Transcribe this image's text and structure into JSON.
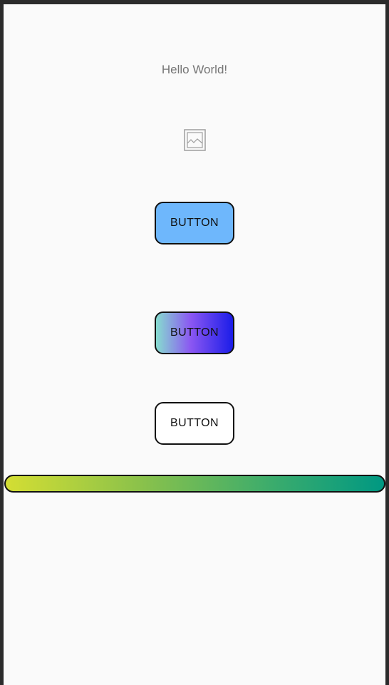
{
  "screen": {
    "hello_text": "Hello World!",
    "image_icon": "image-placeholder-icon"
  },
  "buttons": [
    {
      "label": "BUTTON",
      "style": "solid",
      "color": "#6eb7fc"
    },
    {
      "label": "BUTTON",
      "style": "gradient",
      "colors": [
        "#86dccf",
        "#8b57f2",
        "#1b1de8"
      ]
    },
    {
      "label": "BUTTON",
      "style": "outlined",
      "color": "#ffffff"
    }
  ],
  "gradient_bar": {
    "colors": [
      "#d4de33",
      "#8cc24a",
      "#3cac6c",
      "#009882"
    ]
  }
}
